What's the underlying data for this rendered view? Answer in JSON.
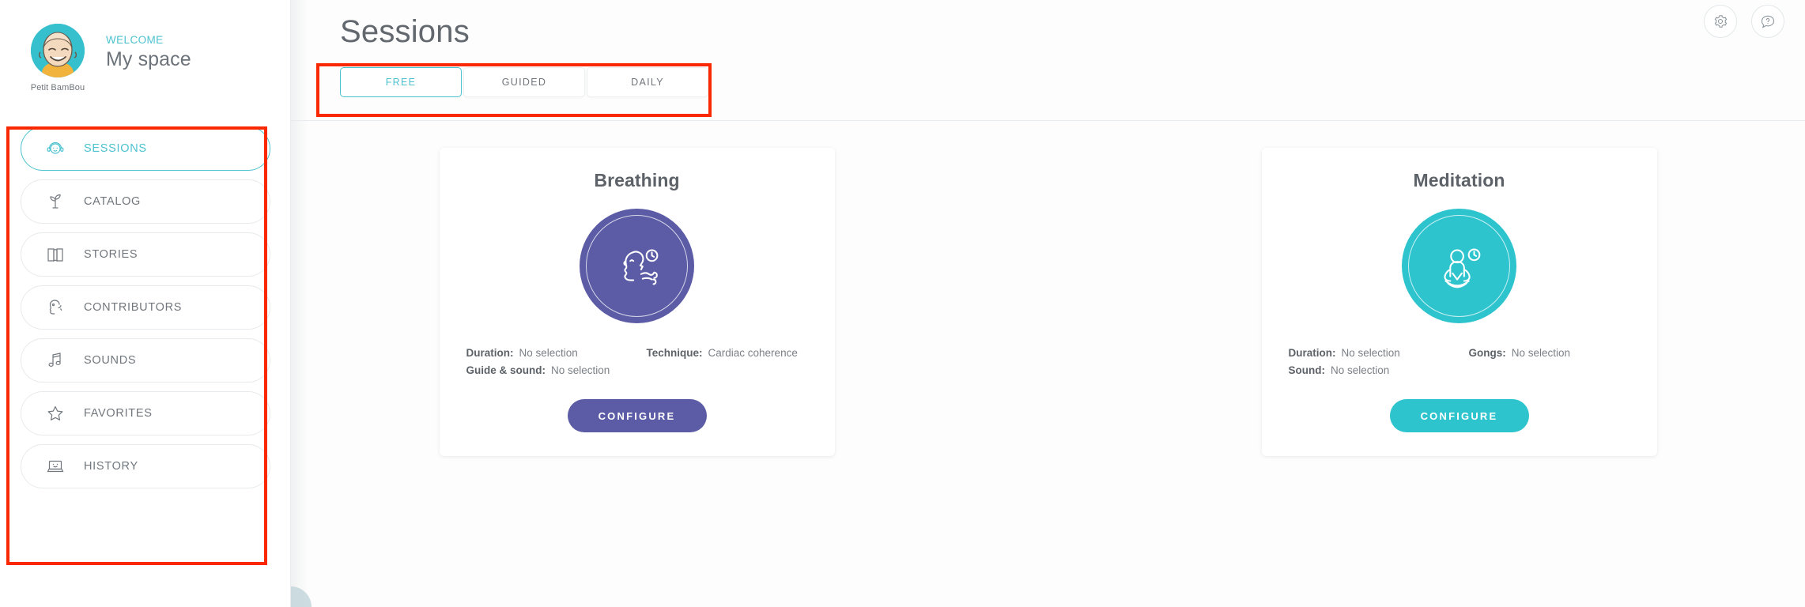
{
  "sidebar": {
    "profile": {
      "avatar_name": "Petit BamBou",
      "welcome_label": "WELCOME",
      "title": "My space",
      "avatar_icon": "user-avatar"
    },
    "items": [
      {
        "label": "SESSIONS",
        "icon": "headphones-face-icon",
        "active": true
      },
      {
        "label": "CATALOG",
        "icon": "sprout-icon",
        "active": false
      },
      {
        "label": "STORIES",
        "icon": "open-book-icon",
        "active": false
      },
      {
        "label": "CONTRIBUTORS",
        "icon": "head-profile-icon",
        "active": false
      },
      {
        "label": "SOUNDS",
        "icon": "music-note-icon",
        "active": false
      },
      {
        "label": "FAVORITES",
        "icon": "star-icon",
        "active": false
      },
      {
        "label": "HISTORY",
        "icon": "laptop-icon",
        "active": false
      }
    ]
  },
  "header": {
    "title": "Sessions",
    "settings_icon": "gear-icon",
    "help_icon": "question-bubble-icon"
  },
  "tabs": [
    {
      "label": "FREE",
      "active": true
    },
    {
      "label": "GUIDED",
      "active": false
    },
    {
      "label": "DAILY",
      "active": false
    }
  ],
  "cards": [
    {
      "title": "Breathing",
      "icon": "breathing-face-clock-icon",
      "color": "#5c5ca6",
      "rows": [
        [
          {
            "key": "Duration:",
            "value": "No selection"
          },
          {
            "key": "Technique:",
            "value": "Cardiac coherence"
          }
        ],
        [
          {
            "key": "Guide & sound:",
            "value": "No selection"
          }
        ]
      ],
      "button_label": "CONFIGURE"
    },
    {
      "title": "Meditation",
      "icon": "meditation-lotus-clock-icon",
      "color": "#2ec4ce",
      "rows": [
        [
          {
            "key": "Duration:",
            "value": "No selection"
          },
          {
            "key": "Gongs:",
            "value": "No selection"
          }
        ],
        [
          {
            "key": "Sound:",
            "value": "No selection"
          }
        ]
      ],
      "button_label": "CONFIGURE"
    }
  ],
  "colors": {
    "teal": "#4cc2cf",
    "purple": "#5c5ca6",
    "annotation": "#fa2800",
    "text_gray": "#6d737a"
  }
}
